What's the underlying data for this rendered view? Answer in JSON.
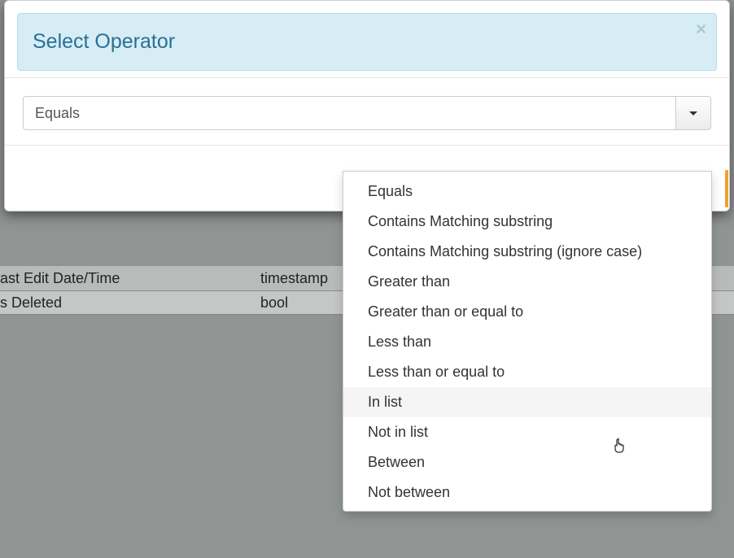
{
  "modal": {
    "title": "Select Operator",
    "close_glyph": "×"
  },
  "combo": {
    "value": "Equals"
  },
  "options": [
    {
      "label": "Equals"
    },
    {
      "label": "Contains Matching substring"
    },
    {
      "label": "Contains Matching substring (ignore case)"
    },
    {
      "label": "Greater than"
    },
    {
      "label": "Greater than or equal to"
    },
    {
      "label": "Less than"
    },
    {
      "label": "Less than or equal to"
    },
    {
      "label": "In list",
      "hover": true
    },
    {
      "label": "Not in list"
    },
    {
      "label": "Between"
    },
    {
      "label": "Not between"
    }
  ],
  "bg": {
    "row1_col1": "ast Edit Date/Time",
    "row1_col2": "timestamp",
    "row2_col1": "s Deleted",
    "row2_col2": "bool"
  },
  "cursor_glyph": "☟"
}
